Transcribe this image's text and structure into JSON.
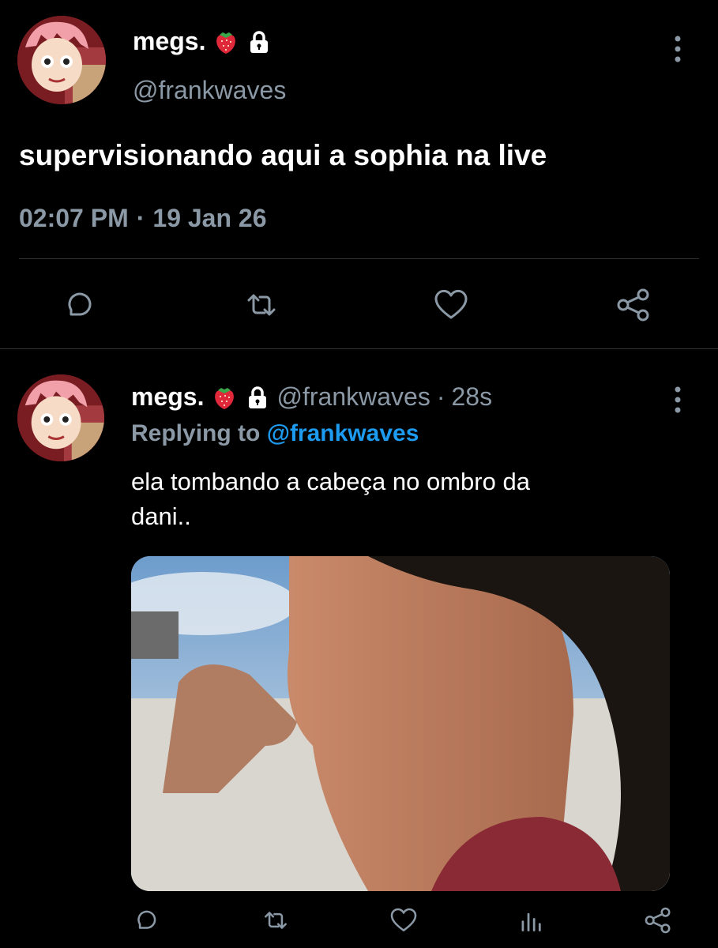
{
  "main_tweet": {
    "name": "megs.",
    "handle": "@frankwaves",
    "text": "supervisionando aqui a sophia na live",
    "timestamp": "02:07 PM",
    "separator": "·",
    "date": "19 Jan 26"
  },
  "reply_tweet": {
    "name": "megs.",
    "handle": "@frankwaves",
    "separator": "·",
    "time_ago": "28s",
    "replying_prefix": "Replying to",
    "replying_to": "@frankwaves",
    "text_line1": "ela tombando a cabeça no ombro da",
    "text_line2": "dani.."
  },
  "icons": {
    "badge_emoji": "strawberry-icon",
    "protected": "lock-icon",
    "more": "more-vertical-icon",
    "reply": "reply-icon",
    "retweet": "retweet-icon",
    "like": "heart-icon",
    "share": "share-icon",
    "analytics": "analytics-icon"
  },
  "colors": {
    "background": "#000000",
    "text_primary": "#ffffff",
    "text_secondary": "#8b98a5",
    "link": "#1d9bf0",
    "divider": "#2f3336",
    "strawberry": "#e0283b"
  }
}
